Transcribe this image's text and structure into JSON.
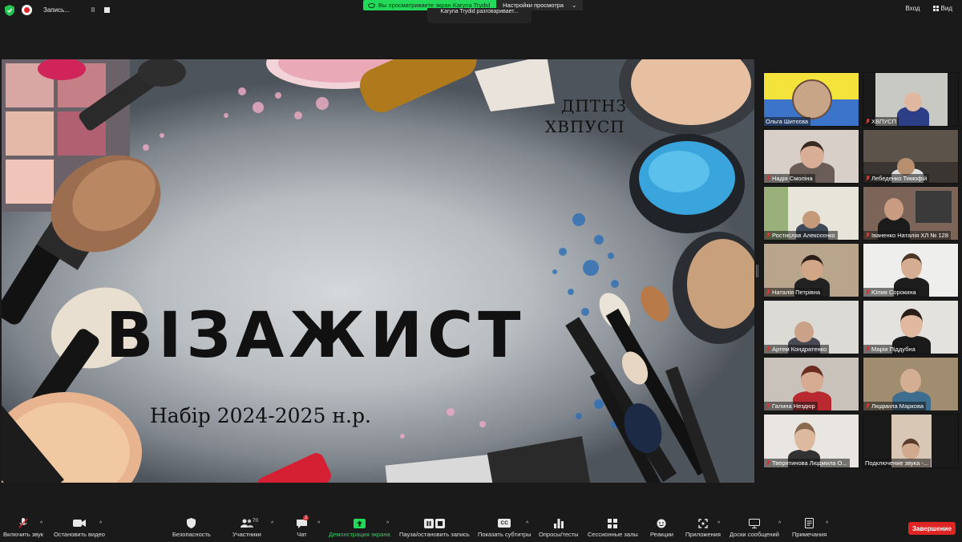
{
  "top_bar": {
    "recording_label": "Запись...",
    "pause_glyph": "II",
    "share_banner": "Вы просматриваете экран Karyna Trydid",
    "view_options": "Настройки просмотра",
    "speaking": "Karyna Trydid разговаривает...",
    "exit_label": "Вход",
    "view_label": "Вид"
  },
  "slide": {
    "title": "ВІЗАЖИСТ",
    "subtitle": "Набір 2024-2025 н.р.",
    "org_line1": "ДПТНЗ",
    "org_line2": "ХВПУСП"
  },
  "participants": [
    {
      "name": "Ольга Шитєєва",
      "muted": false
    },
    {
      "name": "ХВПУСП",
      "muted": true
    },
    {
      "name": "Надія Смоліна",
      "muted": true
    },
    {
      "name": "Лебеденко Тимофій",
      "muted": true
    },
    {
      "name": "Ростислав Алексєєнко",
      "muted": true
    },
    {
      "name": "Іваненко Наталія ХЛ № 128",
      "muted": true
    },
    {
      "name": "Наталія Петрівна",
      "muted": true
    },
    {
      "name": "Юлия Сорокина",
      "muted": true
    },
    {
      "name": "Артем Кондратенко",
      "muted": true
    },
    {
      "name": "Марія Піддубна",
      "muted": true
    },
    {
      "name": "Галина Нездюр",
      "muted": true
    },
    {
      "name": "Людмила Маркова",
      "muted": true
    },
    {
      "name": "Тверитинова Людмила О...",
      "muted": true
    },
    {
      "name": "Подключение звука -...",
      "muted": false
    }
  ],
  "toolbar": {
    "unmute": "Включить звук",
    "stop_video": "Остановить видео",
    "security": "Безопасность",
    "participants": "Участники",
    "participants_count": "70",
    "chat": "Чат",
    "chat_badge": "2",
    "share": "Демонстрация экрана",
    "pause_rec": "Пауза/остановить запись",
    "captions": "Показать субтитры",
    "captions_glyph": "CC",
    "polls": "Опросы/тесты",
    "breakout": "Сессионные залы",
    "reactions": "Реакции",
    "apps": "Приложения",
    "whiteboards": "Доски сообщений",
    "notes": "Примечания",
    "end": "Завершение"
  },
  "colors": {
    "share_green": "#23d959",
    "end_red": "#e02424",
    "muted_red": "#e03131"
  }
}
